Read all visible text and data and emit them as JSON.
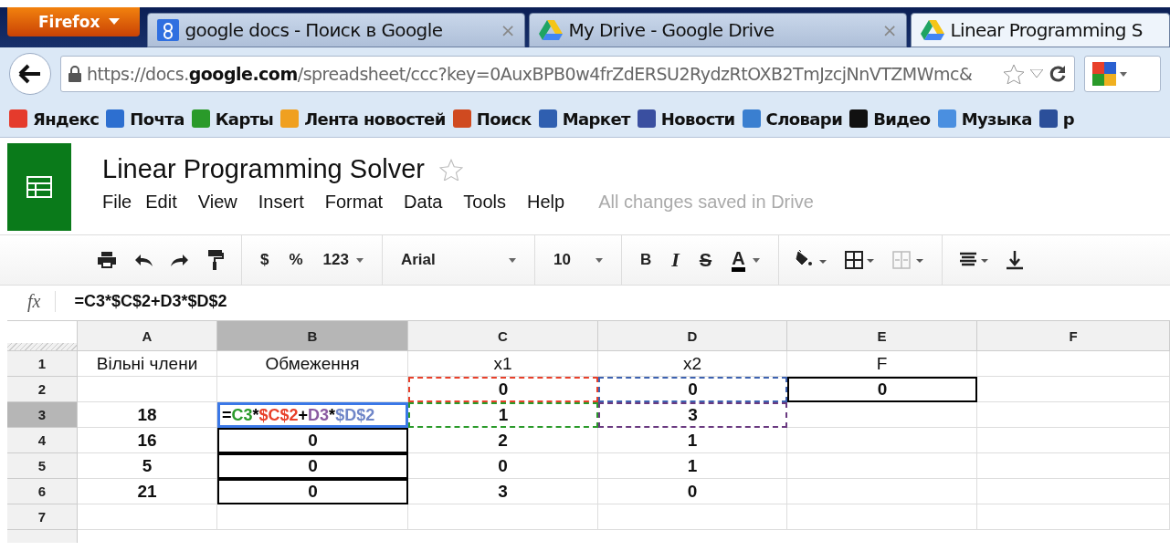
{
  "browser": {
    "menu_button": "Firefox",
    "tabs": [
      {
        "title": "google docs - Поиск в Google",
        "kind": "search",
        "selected": false,
        "close": "×"
      },
      {
        "title": "My Drive - Google Drive",
        "kind": "drive",
        "selected": false,
        "close": "×"
      },
      {
        "title": "Linear Programming S",
        "kind": "drive",
        "selected": true
      }
    ],
    "url": "https://docs.**google.com**/spreadsheet/ccc?key=0AuxBPB0w4frZdERSU2RydzRtOXB2TmJzcjNnVTZMWmc&",
    "bookmarks": [
      {
        "label": "Яндекс",
        "color": "#e53b2c"
      },
      {
        "label": "Почта",
        "color": "#2d6fd0"
      },
      {
        "label": "Карты",
        "color": "#2a9a2a"
      },
      {
        "label": "Лента новостей",
        "color": "#f0a020"
      },
      {
        "label": "Поиск",
        "color": "#d04a20"
      },
      {
        "label": "Маркет",
        "color": "#2f5fb0"
      },
      {
        "label": "Новости",
        "color": "#3a4fa0"
      },
      {
        "label": "Словари",
        "color": "#3a7fd0"
      },
      {
        "label": "Видео",
        "color": "#111111"
      },
      {
        "label": "Музыка",
        "color": "#4a8fe0"
      },
      {
        "label": "р",
        "color": "#2b4f9a"
      }
    ]
  },
  "doc": {
    "title": "Linear Programming Solver",
    "starred": false,
    "menu": [
      "File",
      "Edit",
      "View",
      "Insert",
      "Format",
      "Data",
      "Tools",
      "Help"
    ],
    "status": "All changes saved in Drive",
    "toolbar": [
      {
        "kind": "print"
      },
      {
        "kind": "undo"
      },
      {
        "kind": "redo"
      },
      {
        "kind": "paint"
      },
      {
        "kind": "sep"
      },
      {
        "kind": "text",
        "label": "$"
      },
      {
        "kind": "text",
        "label": "%"
      },
      {
        "kind": "dropdown",
        "label": "123"
      },
      {
        "kind": "sep"
      },
      {
        "kind": "font",
        "label": "Arial"
      },
      {
        "kind": "sep"
      },
      {
        "kind": "font",
        "label": "10"
      },
      {
        "kind": "sep"
      },
      {
        "kind": "bold",
        "label": "B"
      },
      {
        "kind": "italic",
        "label": "I"
      },
      {
        "kind": "strike",
        "label": "S"
      },
      {
        "kind": "color",
        "label": "A"
      },
      {
        "kind": "sep"
      },
      {
        "kind": "fill"
      },
      {
        "kind": "borders"
      },
      {
        "kind": "merge",
        "disabled": true
      },
      {
        "kind": "sep"
      },
      {
        "kind": "align"
      },
      {
        "kind": "valign"
      }
    ],
    "function_label": "fx",
    "formula": "=C3*$C$2+D3*$D$2"
  },
  "sheet": {
    "columns": [
      {
        "label": "A",
        "selected": false
      },
      {
        "label": "B",
        "selected": true
      },
      {
        "label": "C",
        "selected": false
      },
      {
        "label": "D",
        "selected": false
      },
      {
        "label": "E",
        "selected": false
      },
      {
        "label": "F",
        "selected": false
      }
    ],
    "rows": [
      {
        "number": "1",
        "selected": false,
        "cells": [
          {
            "text": "Вільні члени"
          },
          {
            "text": "Обмеження"
          },
          {
            "text": "x1"
          },
          {
            "text": "x2"
          },
          {
            "text": "F"
          },
          {}
        ]
      },
      {
        "number": "2",
        "selected": false,
        "cells": [
          {},
          {},
          {
            "text": "0",
            "bold": true,
            "range": true,
            "color": "#e8402a"
          },
          {
            "text": "0",
            "bold": true,
            "range": true,
            "color": "#3d62b0"
          },
          {
            "text": "0",
            "bold": true,
            "bordered": true
          },
          {}
        ]
      },
      {
        "number": "3",
        "selected": true,
        "cells": [
          {
            "text": "18",
            "bold": true
          },
          {
            "kind": "editor",
            "parts": [
              {
                "text": "=",
                "color": "#000000"
              },
              {
                "text": "C3",
                "color": "#2a9a2a"
              },
              {
                "text": "*",
                "color": "#000000"
              },
              {
                "text": "$C$2",
                "color": "#e8402a"
              },
              {
                "text": "+",
                "color": "#000000"
              },
              {
                "text": "D3",
                "color": "#8a5aa0"
              },
              {
                "text": "*",
                "color": "#000000"
              },
              {
                "text": "$D$2",
                "color": "#6f86c8"
              }
            ]
          },
          {
            "text": "1",
            "bold": true,
            "range": true,
            "color": "#2a9a2a"
          },
          {
            "text": "3",
            "bold": true,
            "range": true,
            "color": "#6a3a80"
          },
          {},
          {}
        ]
      },
      {
        "number": "4",
        "selected": false,
        "cells": [
          {
            "text": "16",
            "bold": true
          },
          {
            "text": "0",
            "bold": true,
            "bordered": true
          },
          {
            "text": "2",
            "bold": true
          },
          {
            "text": "1",
            "bold": true
          },
          {},
          {}
        ]
      },
      {
        "number": "5",
        "selected": false,
        "cells": [
          {
            "text": "5",
            "bold": true
          },
          {
            "text": "0",
            "bold": true,
            "bordered": true
          },
          {
            "text": "0",
            "bold": true
          },
          {
            "text": "1",
            "bold": true
          },
          {},
          {}
        ]
      },
      {
        "number": "6",
        "selected": false,
        "cells": [
          {
            "text": "21",
            "bold": true
          },
          {
            "text": "0",
            "bold": true,
            "bordered": true
          },
          {
            "text": "3",
            "bold": true
          },
          {
            "text": "0",
            "bold": true
          },
          {},
          {}
        ]
      },
      {
        "number": "7",
        "selected": false,
        "cells": [
          {},
          {},
          {},
          {},
          {},
          {}
        ]
      }
    ]
  }
}
